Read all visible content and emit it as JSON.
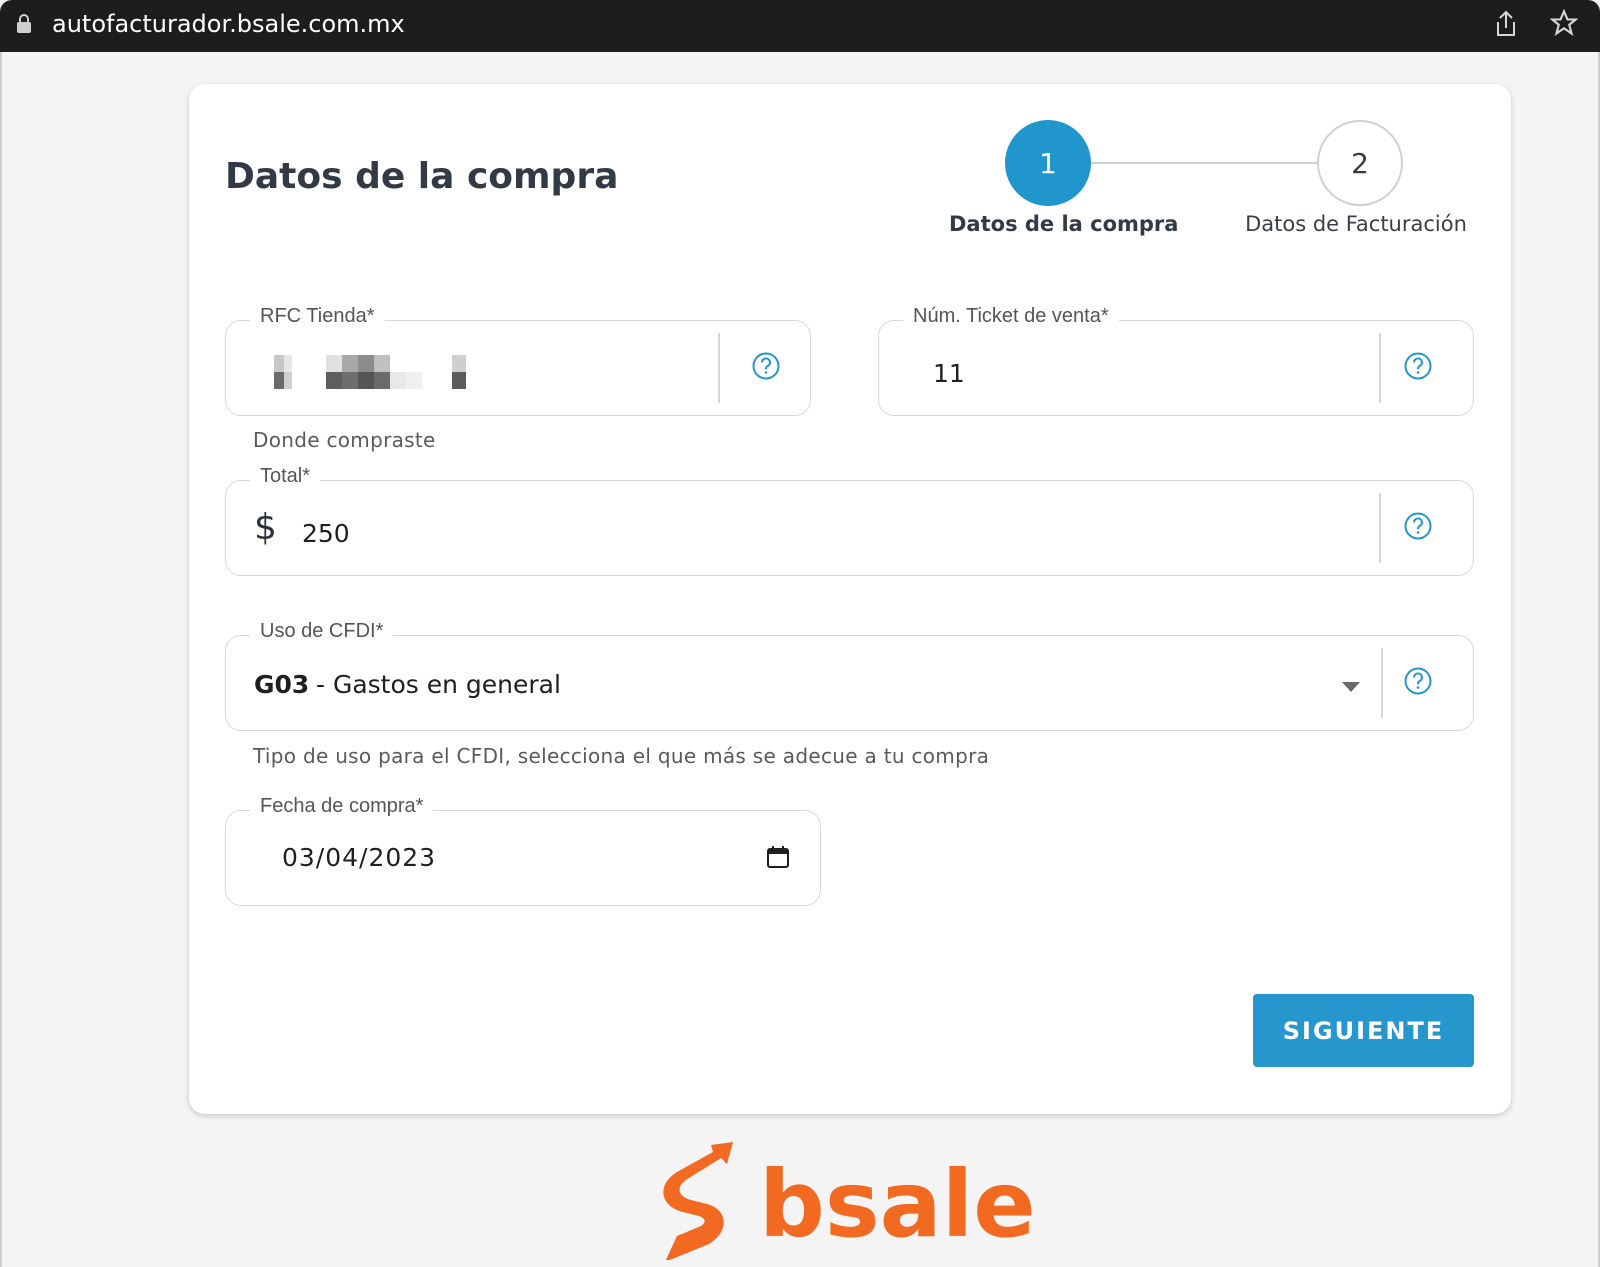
{
  "browser": {
    "url": "autofacturador.bsale.com.mx"
  },
  "page": {
    "title": "Datos de la compra"
  },
  "stepper": {
    "steps": [
      {
        "number": "1",
        "label": "Datos de la compra",
        "active": true
      },
      {
        "number": "2",
        "label": "Datos de Facturación",
        "active": false
      }
    ]
  },
  "form": {
    "rfc": {
      "label": "RFC Tienda*",
      "hint": "Donde compraste"
    },
    "ticket": {
      "label": "Núm. Ticket de venta*",
      "value": "11"
    },
    "total": {
      "label": "Total*",
      "currency": "$",
      "value": "250"
    },
    "cfdi": {
      "label": "Uso de CFDI*",
      "code": "G03",
      "description": "- Gastos en general",
      "hint": "Tipo de uso para el CFDI, selecciona el que más se adecue a tu compra"
    },
    "date": {
      "label": "Fecha de compra*",
      "value": "03/04/2023"
    }
  },
  "actions": {
    "next_label": "SIGUIENTE"
  },
  "footer": {
    "logo_text": "bsale"
  },
  "colors": {
    "accent": "#2196cc",
    "brand_orange": "#f26a21"
  },
  "icons": [
    "lock-icon",
    "share-icon",
    "star-icon",
    "help-icon",
    "dropdown-arrow-icon",
    "calendar-icon"
  ]
}
